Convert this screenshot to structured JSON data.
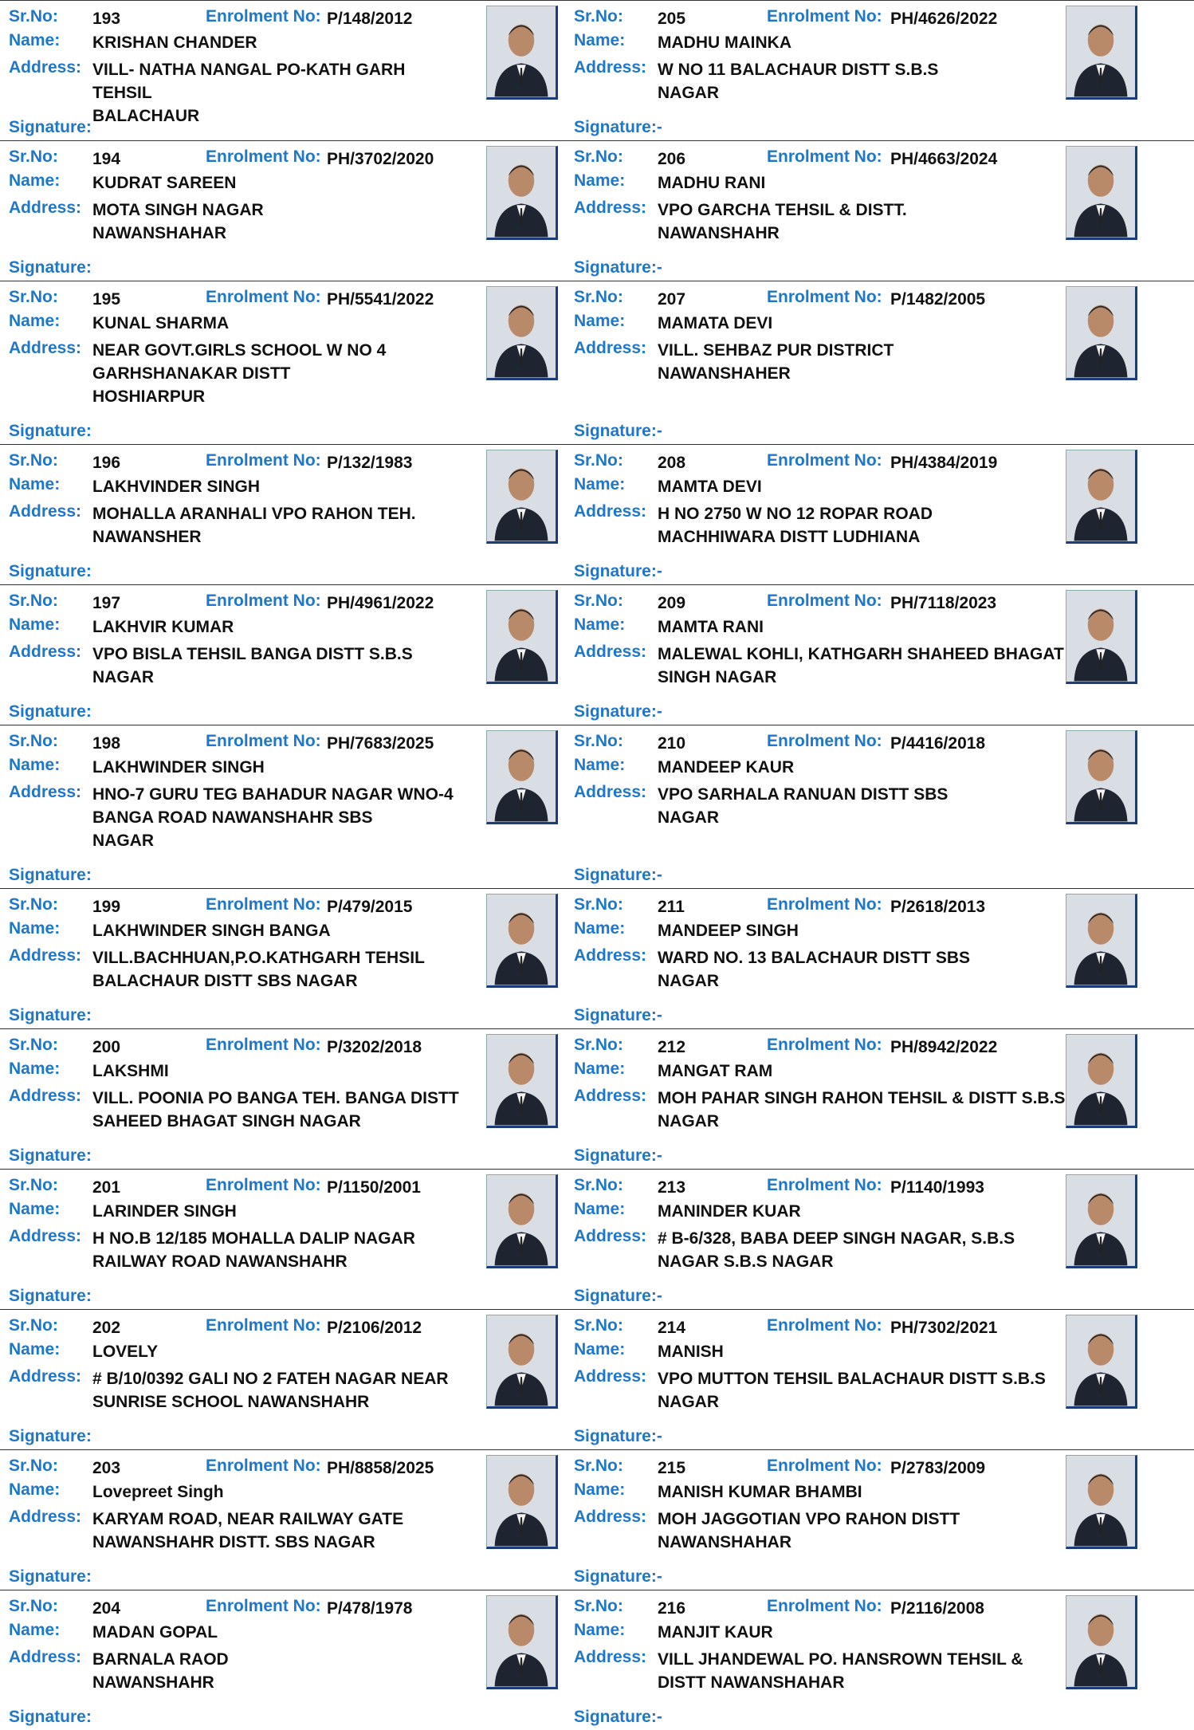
{
  "labels": {
    "srno": "Sr.No:",
    "enrolment": "Enrolment No:",
    "name": "Name:",
    "address": "Address:",
    "signature_left": "Signature:",
    "signature_right": "Signature:-"
  },
  "left": [
    {
      "srno": "193",
      "enrolment": "P/148/2012",
      "name": "KRISHAN CHANDER",
      "address": [
        "VILL- NATHA NANGAL PO-KATH GARH TEHSIL",
        "BALACHAUR"
      ]
    },
    {
      "srno": "194",
      "enrolment": "PH/3702/2020",
      "name": "KUDRAT SAREEN",
      "address": [
        "MOTA SINGH NAGAR",
        "NAWANSHAHAR"
      ]
    },
    {
      "srno": "195",
      "enrolment": "PH/5541/2022",
      "name": "KUNAL SHARMA",
      "address": [
        "NEAR GOVT.GIRLS SCHOOL W NO 4",
        "GARHSHANAKAR DISTT",
        "HOSHIARPUR"
      ]
    },
    {
      "srno": "196",
      "enrolment": "P/132/1983",
      "name": "LAKHVINDER SINGH",
      "address": [
        "MOHALLA ARANHALI VPO RAHON TEH.",
        "NAWANSHER"
      ]
    },
    {
      "srno": "197",
      "enrolment": "PH/4961/2022",
      "name": "LAKHVIR KUMAR",
      "address": [
        "VPO BISLA TEHSIL BANGA DISTT S.B.S",
        "NAGAR"
      ]
    },
    {
      "srno": "198",
      "enrolment": "PH/7683/2025",
      "name": "LAKHWINDER SINGH",
      "address": [
        "HNO-7 GURU TEG BAHADUR NAGAR WNO-4",
        "BANGA ROAD NAWANSHAHR SBS",
        "NAGAR"
      ]
    },
    {
      "srno": "199",
      "enrolment": "P/479/2015",
      "name": "LAKHWINDER SINGH BANGA",
      "address": [
        "VILL.BACHHUAN,P.O.KATHGARH TEHSIL",
        "BALACHAUR DISTT SBS NAGAR"
      ]
    },
    {
      "srno": "200",
      "enrolment": "P/3202/2018",
      "name": "LAKSHMI",
      "address": [
        "VILL. POONIA PO BANGA TEH. BANGA DISTT",
        "SAHEED BHAGAT SINGH NAGAR"
      ]
    },
    {
      "srno": "201",
      "enrolment": "P/1150/2001",
      "name": "LARINDER SINGH",
      "address": [
        "H NO.B 12/185 MOHALLA DALIP NAGAR",
        "RAILWAY ROAD NAWANSHAHR"
      ]
    },
    {
      "srno": "202",
      "enrolment": "P/2106/2012",
      "name": "LOVELY",
      "address": [
        "# B/10/0392 GALI NO 2 FATEH NAGAR NEAR",
        "SUNRISE SCHOOL NAWANSHAHR"
      ]
    },
    {
      "srno": "203",
      "enrolment": "PH/8858/2025",
      "name": "Lovepreet Singh",
      "address": [
        "KARYAM ROAD, NEAR RAILWAY GATE",
        "NAWANSHAHR DISTT. SBS NAGAR"
      ]
    },
    {
      "srno": "204",
      "enrolment": "P/478/1978",
      "name": "MADAN GOPAL",
      "address": [
        "BARNALA RAOD",
        "NAWANSHAHR"
      ]
    }
  ],
  "right": [
    {
      "srno": "205",
      "enrolment": "PH/4626/2022",
      "name": "MADHU MAINKA",
      "address": [
        "W NO 11 BALACHAUR DISTT S.B.S",
        "NAGAR"
      ]
    },
    {
      "srno": "206",
      "enrolment": "PH/4663/2024",
      "name": "MADHU RANI",
      "address": [
        "VPO GARCHA TEHSIL  & DISTT.",
        "NAWANSHAHR"
      ]
    },
    {
      "srno": "207",
      "enrolment": "P/1482/2005",
      "name": "MAMATA DEVI",
      "address": [
        "VILL. SEHBAZ PUR  DISTRICT",
        "NAWANSHAHER"
      ]
    },
    {
      "srno": "208",
      "enrolment": "PH/4384/2019",
      "name": "MAMTA DEVI",
      "address": [
        "H NO 2750 W NO 12 ROPAR ROAD",
        "MACHHIWARA DISTT LUDHIANA"
      ]
    },
    {
      "srno": "209",
      "enrolment": "PH/7118/2023",
      "name": "MAMTA RANI",
      "address": [
        "MALEWAL KOHLI, KATHGARH SHAHEED BHAGAT",
        "SINGH NAGAR"
      ]
    },
    {
      "srno": "210",
      "enrolment": "P/4416/2018",
      "name": "MANDEEP KAUR",
      "address": [
        "VPO SARHALA RANUAN  DISTT SBS",
        "NAGAR"
      ]
    },
    {
      "srno": "211",
      "enrolment": "P/2618/2013",
      "name": "MANDEEP SINGH",
      "address": [
        "WARD NO. 13 BALACHAUR DISTT SBS",
        "NAGAR"
      ]
    },
    {
      "srno": "212",
      "enrolment": "PH/8942/2022",
      "name": "MANGAT RAM",
      "address": [
        "MOH PAHAR SINGH RAHON TEHSIL & DISTT S.B.S",
        "NAGAR"
      ]
    },
    {
      "srno": "213",
      "enrolment": "P/1140/1993",
      "name": "MANINDER KUAR",
      "address": [
        "# B-6/328, BABA DEEP SINGH NAGAR, S.B.S",
        "NAGAR S.B.S NAGAR"
      ]
    },
    {
      "srno": "214",
      "enrolment": "PH/7302/2021",
      "name": "MANISH",
      "address": [
        "VPO MUTTON TEHSIL BALACHAUR DISTT S.B.S",
        "NAGAR"
      ]
    },
    {
      "srno": "215",
      "enrolment": "P/2783/2009",
      "name": "MANISH KUMAR BHAMBI",
      "address": [
        "MOH JAGGOTIAN VPO RAHON DISTT",
        "NAWANSHAHAR"
      ]
    },
    {
      "srno": "216",
      "enrolment": "P/2116/2008",
      "name": "MANJIT KAUR",
      "address": [
        "VILL  JHANDEWAL PO. HANSROWN TEHSIL &",
        "DISTT NAWANSHAHAR"
      ]
    }
  ]
}
